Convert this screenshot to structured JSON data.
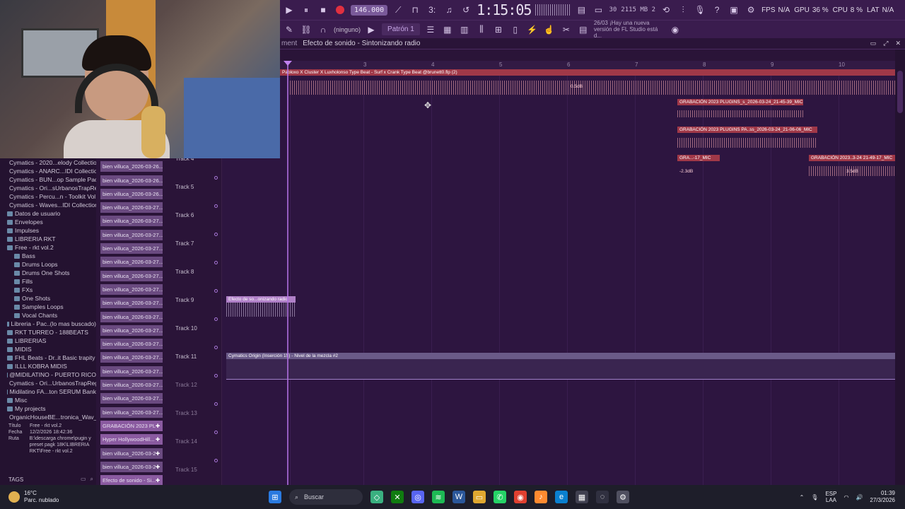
{
  "toolbar": {
    "bpm": "146.000",
    "time": "1:15:05",
    "ram": "2115 MB",
    "ram_voices": "2",
    "cpu_val": "30",
    "gpu_label": "GPU",
    "gpu_value": "36 %",
    "cpu_label": "CPU",
    "cpu_value": "8 %",
    "fps_label": "FPS",
    "fps_value": "N/A",
    "lat_label": "LAT",
    "lat_value": "N/A",
    "snap": "(ninguno)",
    "pattern": "Patrón 1",
    "news_date": "26/03",
    "news_text": "¡Hay una nueva versión de FL Studio está d...",
    "pattern_arrow": "▶"
  },
  "playlist": {
    "breadcrumb_prefix": "ment",
    "breadcrumb": "Efecto de sonido - Sintonizando radio",
    "ruler": [
      "2",
      "3",
      "4",
      "5",
      "6",
      "7",
      "8",
      "9",
      "10"
    ],
    "clips": {
      "beat": "Pabloxo X Cluster X Luxholonso Type Beat - Surf x Crank Type Beat @brunett0.flp (2)",
      "beat_db": "0.5dB",
      "grab1": "GRABACIÓN 2023 PLUGINS_s_2026-03-24_21-45-39_MIC",
      "grab2": "GRABACIÓN 2023 PLUGINS PA..ss_2026-03-24_21-06-06_MIC",
      "grab3": "GRA...-17_MIC",
      "grab3_db": "-2.3dB",
      "grab4": "GRABACIÓN 2023..3-24 21-49-17_MIC",
      "grab4_db": "3.5dB",
      "efecto": "Efecto de so...onizando radio",
      "auto": "Cymatics Origin (Inserción 15) - Nivel de la mezcla #2"
    }
  },
  "tracks": [
    "Track 4",
    "Track 5",
    "Track 6",
    "Track 7",
    "Track 8",
    "Track 9",
    "Track 10",
    "Track 11",
    "Track 12",
    "Track 13",
    "Track 14",
    "Track 15"
  ],
  "browser": {
    "items": [
      {
        "label": "Cymatics - 2020...elody Collection",
        "level": "l0"
      },
      {
        "label": "Cymatics - ANARC...IDI Collection",
        "level": "l0"
      },
      {
        "label": "Cymatics - BUN...op Sample Pack",
        "level": "l0"
      },
      {
        "label": "Cymatics - Ori...sUrbanosTrapReg",
        "level": "l0"
      },
      {
        "label": "Cymatics - Percu...n - Toolkit Vol 1",
        "level": "l0"
      },
      {
        "label": "Cymatics - Waves...IDI Collection",
        "level": "l0"
      },
      {
        "label": "Datos de usuario",
        "level": "l0"
      },
      {
        "label": "Envelopes",
        "level": "l0"
      },
      {
        "label": "Impulses",
        "level": "l0"
      },
      {
        "label": "LIBRERIA RKT",
        "level": "l0"
      },
      {
        "label": "Free - rkt vol.2",
        "level": "l1"
      },
      {
        "label": "Bass",
        "level": "l2"
      },
      {
        "label": "Drums Loops",
        "level": "l2"
      },
      {
        "label": "Drums One Shots",
        "level": "l2"
      },
      {
        "label": "Fills",
        "level": "l2"
      },
      {
        "label": "FXs",
        "level": "l2"
      },
      {
        "label": "One Shots",
        "level": "l2"
      },
      {
        "label": "Samples Loops",
        "level": "l2"
      },
      {
        "label": "Vocal Chants",
        "level": "l2"
      },
      {
        "label": "Libreria - Pac..(lo mas buscado)",
        "level": "l1"
      },
      {
        "label": "RKT  TURREO - 188BEATS",
        "level": "l1"
      },
      {
        "label": "LIBRERIAS",
        "level": "l0"
      },
      {
        "label": "MIDIS",
        "level": "l0"
      },
      {
        "label": "FHL Beats - Dr..it Basic trapity",
        "level": "l1"
      },
      {
        "label": "ILLL KOBRA MIDIS",
        "level": "l1"
      },
      {
        "label": "@MIDILATINO - PUERTO RICO",
        "level": "l1"
      },
      {
        "label": "Cymatics - Ori...UrbanosTrapReg",
        "level": "l1"
      },
      {
        "label": "Midilatino FA...ton SERUM Bank",
        "level": "l1"
      },
      {
        "label": "Misc",
        "level": "l0"
      },
      {
        "label": "My projects",
        "level": "l0"
      },
      {
        "label": "OrganicHouseBE...tronica_Wav_SP",
        "level": "l0"
      }
    ],
    "info": {
      "title_k": "Título",
      "title_v": "Free - rkt vol.2",
      "date_k": "Fecha",
      "date_v": "12/2/2026 18:42:36",
      "path_k": "Ruta",
      "path_v": "B:\\descarga chrome\\pugin y preset pagk 18K\\LIBRERIA RKT\\Free - rkt vol.2"
    },
    "tags": "TAGS"
  },
  "picker": [
    "bien villuca_2026-03-26...",
    "bien villuca_2026-03-26...",
    "bien villuca_2026-03-26...",
    "bien villuca_2026-03-27...",
    "bien villuca_2026-03-27...",
    "bien villuca_2026-03-27...",
    "bien villuca_2026-03-27...",
    "bien villuca_2026-03-27...",
    "bien villuca_2026-03-27...",
    "bien villuca_2026-03-27...",
    "bien villuca_2026-03-27...",
    "bien villuca_2026-03-27...",
    "bien villuca_2026-03-27...",
    "bien villuca_2026-03-27...",
    "bien villuca_2026-03-27...",
    "bien villuca_2026-03-27...",
    "bien villuca_2026-03-27...",
    "bien villuca_2026-03-27...",
    "bien villuca_2026-03-27...",
    "GRABACIÓN 2023 PLU...",
    "Hyper HollywoodHill...",
    "bien villuca_2026-03-27...",
    "bien villuca_2026-03-27...",
    "Efecto de sonido - Si..."
  ],
  "taskbar": {
    "temp": "16°C",
    "weather": "Parc. nublado",
    "search": "Buscar",
    "lang1": "ESP",
    "lang2": "LAA",
    "time": "01:39",
    "date": "27/3/2026"
  },
  "colors": {
    "accent": "#b070e0",
    "clip_red": "#a03848",
    "bg": "#2d1540"
  }
}
